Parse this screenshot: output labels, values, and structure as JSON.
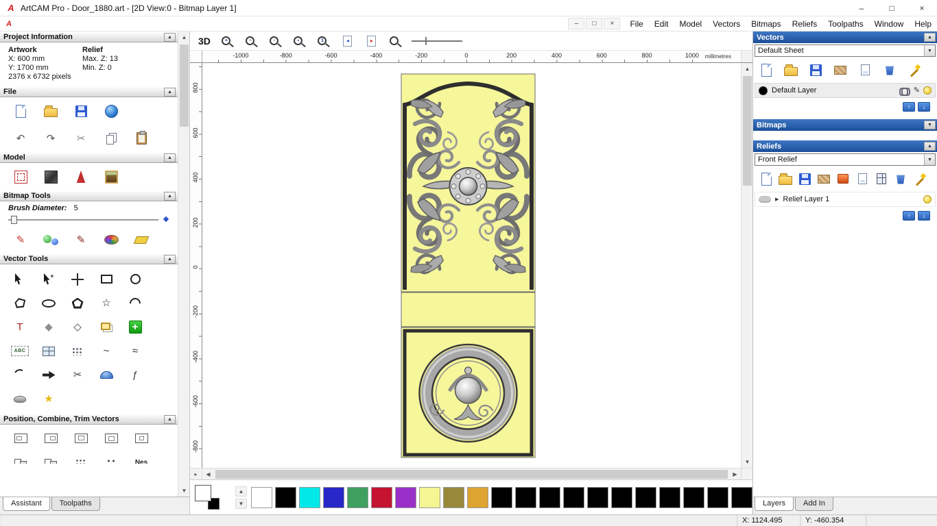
{
  "ui": {
    "collapse_up": "▲",
    "collapse_down": "▼",
    "scroll_up": "▲",
    "scroll_down": "▼",
    "scroll_left": "◀",
    "scroll_right": "▶",
    "arrow_up": "↑",
    "arrow_down": "↓",
    "combo_arrow": "▼",
    "expander": "▶",
    "corner_glyph": "▸"
  },
  "titlebar": {
    "logo_letter": "A",
    "title": "ArtCAM Pro - Door_1880.art - [2D View:0 - Bitmap Layer 1]",
    "minimize_glyph": "–",
    "maximize_glyph": "□",
    "close_glyph": "×"
  },
  "menubar": {
    "logo_letter": "A",
    "items": [
      {
        "name": "menu-file",
        "label": "File"
      },
      {
        "name": "menu-edit",
        "label": "Edit"
      },
      {
        "name": "menu-model",
        "label": "Model"
      },
      {
        "name": "menu-vectors",
        "label": "Vectors"
      },
      {
        "name": "menu-bitmaps",
        "label": "Bitmaps"
      },
      {
        "name": "menu-reliefs",
        "label": "Reliefs"
      },
      {
        "name": "menu-toolpaths",
        "label": "Toolpaths"
      },
      {
        "name": "menu-window",
        "label": "Window"
      },
      {
        "name": "menu-help",
        "label": "Help"
      }
    ],
    "mdi_minimize": "–",
    "mdi_restore": "□",
    "mdi_close": "×"
  },
  "assistant": {
    "project_information": {
      "title": "Project Information",
      "artwork_heading": "Artwork",
      "relief_heading": "Relief",
      "x": "X: 600 mm",
      "y": "Y: 1700 mm",
      "pixels": "2376 x 6732 pixels",
      "max_z": "Max. Z: 13",
      "min_z": "Min. Z: 0"
    },
    "file": {
      "title": "File",
      "tools_row1": [
        {
          "name": "new-model-icon",
          "shape": "doc"
        },
        {
          "name": "open-model-icon",
          "shape": "folder"
        },
        {
          "name": "save-model-icon",
          "shape": "floppy"
        },
        {
          "name": "export-model-icon",
          "shape": "globe"
        }
      ],
      "tools_row2": [
        {
          "name": "undo-icon",
          "glyph": "↶",
          "color": "#555555"
        },
        {
          "name": "redo-icon",
          "glyph": "↷",
          "color": "#555555"
        },
        {
          "name": "cut-icon",
          "glyph": "✂",
          "color": "#888888"
        },
        {
          "name": "copy-icon",
          "shape": "copy"
        },
        {
          "name": "paste-icon",
          "shape": "paste"
        }
      ]
    },
    "model": {
      "title": "Model",
      "tools": [
        {
          "name": "set-model-size-icon",
          "shape": "model-size"
        },
        {
          "name": "model-material-icon",
          "shape": "material"
        },
        {
          "name": "model-lighting-icon",
          "shape": "cone"
        },
        {
          "name": "load-bitmap-icon",
          "shape": "picture"
        }
      ]
    },
    "bitmap_tools": {
      "title": "Bitmap Tools",
      "brush_diameter_label": "Brush Diameter:",
      "brush_diameter_value": "5",
      "tools": [
        {
          "name": "paint-brush-icon",
          "glyph": "✎",
          "color": "#c0392b"
        },
        {
          "name": "flood-fill-icon",
          "shape": "flood"
        },
        {
          "name": "paint-selective-icon",
          "glyph": "✎",
          "color": "#8a2424"
        },
        {
          "name": "colour-palette-icon",
          "shape": "palette"
        },
        {
          "name": "eraser-icon",
          "shape": "eraser"
        }
      ]
    },
    "vector_tools": {
      "title": "Vector Tools",
      "tools": [
        {
          "name": "select-vectors-icon",
          "shape": "cursor"
        },
        {
          "name": "node-editing-icon",
          "shape": "cursor",
          "glyph": "+",
          "color": "#222222"
        },
        {
          "name": "transform-vectors-icon",
          "shape": "move4"
        },
        {
          "name": "create-rectangle-icon",
          "shape": "rect-tool"
        },
        {
          "name": "create-circle-icon",
          "shape": "circle-tool"
        },
        {
          "name": "create-polyline-icon",
          "shape": "lasso"
        },
        {
          "name": "create-ellipse-icon",
          "shape": "ellipse-tool"
        },
        {
          "name": "create-polygon-icon",
          "shape": "pentagon"
        },
        {
          "name": "create-star-icon",
          "glyph": "☆",
          "color": "#111111"
        },
        {
          "name": "create-arc-icon",
          "shape": "arc"
        },
        {
          "name": "create-text-icon",
          "glyph": "T",
          "color": "#b22222"
        },
        {
          "name": "measure-icon",
          "glyph": "◆",
          "color": "#8f8f8f"
        },
        {
          "name": "fillet-icon",
          "glyph": "◇",
          "color": "#444444"
        },
        {
          "name": "offset-vector-icon",
          "shape": "offset"
        },
        {
          "name": "block-paste-icon",
          "shape": "green-plus",
          "glyph": "+"
        },
        {
          "name": "create-text-block-icon",
          "shape": "abc-box",
          "glyph": "ABC"
        },
        {
          "name": "make-grid-icon",
          "shape": "grid"
        },
        {
          "name": "paste-array-icon",
          "shape": "dots"
        },
        {
          "name": "fit-curve-icon",
          "glyph": "~",
          "color": "#333333"
        },
        {
          "name": "join-vectors-icon",
          "glyph": "≈",
          "color": "#333333"
        },
        {
          "name": "arc-segment-icon",
          "shape": "arc2"
        },
        {
          "name": "wrap-vectors-icon",
          "shape": "arrow-r"
        },
        {
          "name": "trim-vectors-icon",
          "glyph": "✂",
          "color": "#444444"
        },
        {
          "name": "create-dome-icon",
          "shape": "dome"
        },
        {
          "name": "spline-tool-icon",
          "glyph": "ƒ",
          "color": "#444444"
        },
        {
          "name": "interactive-distort-icon",
          "shape": "blob"
        },
        {
          "name": "vector-doctor-icon",
          "glyph": "★",
          "color": "#e8b90f"
        }
      ]
    },
    "position_tools": {
      "title": "Position, Combine, Trim Vectors",
      "row1": [
        {
          "name": "align-left-icon",
          "shape": "al-left"
        },
        {
          "name": "align-right-icon",
          "shape": "al-right"
        },
        {
          "name": "align-top-icon",
          "shape": "al-top"
        },
        {
          "name": "align-bottom-icon",
          "shape": "al-bottom"
        },
        {
          "name": "align-centre-icon",
          "shape": "al-center"
        }
      ],
      "row2": [
        {
          "name": "group-vectors-icon",
          "shape": "sq2"
        },
        {
          "name": "ungroup-vectors-icon",
          "shape": "sq2"
        },
        {
          "name": "block-copy-icon",
          "shape": "dots"
        },
        {
          "name": "paste-along-curve-icon",
          "shape": "tri-dots"
        },
        {
          "name": "nesting-icon",
          "shape": "tool-label",
          "glyph": "Nes"
        }
      ]
    },
    "tabs": [
      {
        "name": "tab-assistant",
        "label": "Assistant",
        "active": true
      },
      {
        "name": "tab-toolpaths",
        "label": "Toolpaths",
        "active": false
      }
    ]
  },
  "view": {
    "toolbar": {
      "threed_button": "3D",
      "icons": [
        {
          "name": "zoom-in-icon",
          "shape": "mag",
          "glyph": "+"
        },
        {
          "name": "zoom-out-icon",
          "shape": "mag",
          "glyph": "−"
        },
        {
          "name": "zoom-window-icon",
          "shape": "mag",
          "glyph": "▫"
        },
        {
          "name": "zoom-drawing-icon",
          "shape": "mag",
          "glyph": "▪"
        },
        {
          "name": "zoom-100-icon",
          "shape": "mag",
          "glyph": "1"
        },
        {
          "name": "previous-bitmap-layer-icon",
          "shape": "page-left",
          "glyph": "◂",
          "color": "#2255cc"
        },
        {
          "name": "next-bitmap-layer-icon",
          "shape": "page-right",
          "glyph": "▸",
          "color": "#cc3322"
        },
        {
          "name": "zoom-objects-icon",
          "shape": "mag"
        },
        {
          "name": "line-width-control",
          "shape": "line-slider"
        }
      ]
    },
    "ruler": {
      "horizontal_labels": [
        "-1000",
        "-800",
        "-600",
        "-400",
        "-200",
        "0",
        "200",
        "400",
        "600",
        "800",
        "1000"
      ],
      "unit": "millimetres",
      "vertical_labels": [
        "800",
        "600",
        "400",
        "200",
        "0",
        "-200",
        "-400",
        "-600",
        "-800"
      ]
    },
    "palette": {
      "primary": "#ffffff",
      "secondary": "#000000",
      "colors": [
        "#ffffff",
        "#000000",
        "#00e8e8",
        "#2828c8",
        "#3fa060",
        "#c41432",
        "#9a30c8",
        "#f5f593",
        "#97883a",
        "#dda432",
        "#000000",
        "#000000",
        "#000000",
        "#000000",
        "#000000",
        "#000000",
        "#000000",
        "#000000",
        "#000000",
        "#000000",
        "#000000"
      ]
    }
  },
  "layers_panel": {
    "vectors": {
      "title": "Vectors",
      "sheet_selector": "Default Sheet",
      "toolbar": [
        {
          "name": "import-vector-data-icon",
          "shape": "doc"
        },
        {
          "name": "load-vector-layer-icon",
          "shape": "folder"
        },
        {
          "name": "save-vector-layer-icon",
          "shape": "floppy"
        },
        {
          "name": "vector-texture-icon",
          "shape": "fabric"
        },
        {
          "name": "new-vector-layer-icon",
          "shape": "doc-new"
        },
        {
          "name": "delete-vector-layer-icon",
          "shape": "trash"
        },
        {
          "name": "merge-vector-layers-icon",
          "shape": "wand"
        }
      ],
      "layer": {
        "name": "Default Layer",
        "swatch": "#000000"
      }
    },
    "bitmaps": {
      "title": "Bitmaps"
    },
    "reliefs": {
      "title": "Reliefs",
      "relief_selector": "Front Relief",
      "toolbar": [
        {
          "name": "import-relief-icon",
          "shape": "doc"
        },
        {
          "name": "load-relief-layer-icon",
          "shape": "folder"
        },
        {
          "name": "save-relief-layer-icon",
          "shape": "floppy"
        },
        {
          "name": "relief-texture-icon",
          "shape": "fabric"
        },
        {
          "name": "relief-operations-icon",
          "shape": "red-tool"
        },
        {
          "name": "new-relief-layer-icon",
          "shape": "doc-new"
        },
        {
          "name": "calculate-relief-icon",
          "shape": "calc"
        },
        {
          "name": "delete-relief-layer-icon",
          "shape": "trash"
        },
        {
          "name": "merge-relief-layers-icon",
          "shape": "wand"
        }
      ],
      "layer": {
        "name": "Relief Layer 1"
      }
    },
    "tabs": [
      {
        "name": "tab-layers",
        "label": "Layers",
        "active": true
      },
      {
        "name": "tab-add-in",
        "label": "Add In",
        "active": false
      }
    ]
  },
  "statusbar": {
    "x": "X: 1124.495",
    "y": "Y: -460.354"
  }
}
